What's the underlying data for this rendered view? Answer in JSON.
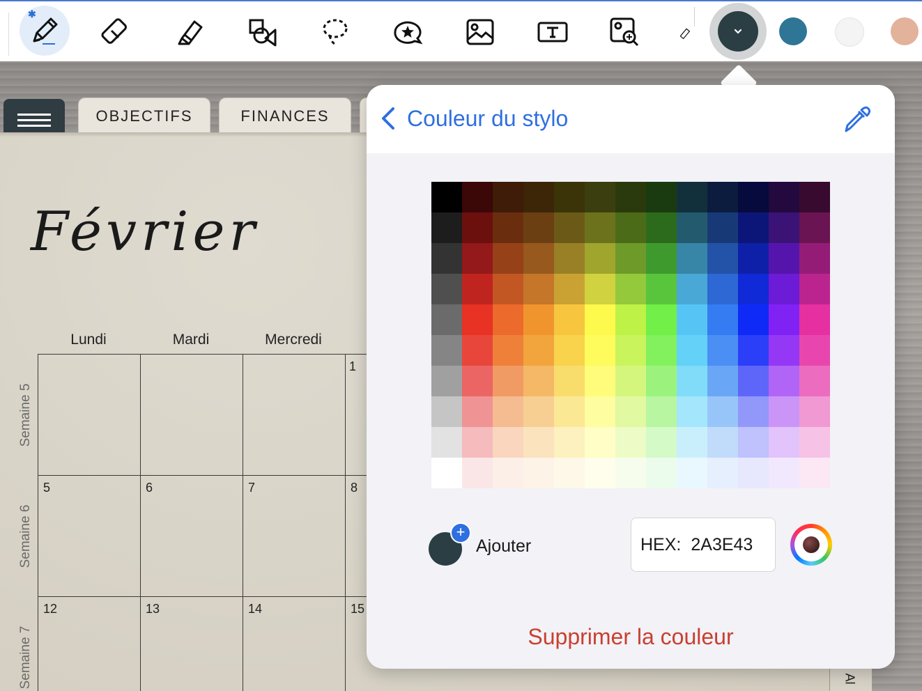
{
  "toolbar": {
    "tools": [
      {
        "name": "pen-tool",
        "icon": "pen-icon",
        "active": true
      },
      {
        "name": "eraser-tool",
        "icon": "eraser-icon"
      },
      {
        "name": "highlighter-tool",
        "icon": "highlighter-icon"
      },
      {
        "name": "shapes-tool",
        "icon": "shapes-icon"
      },
      {
        "name": "lasso-tool",
        "icon": "lasso-icon"
      },
      {
        "name": "sticker-tool",
        "icon": "sticker-icon"
      },
      {
        "name": "image-tool",
        "icon": "image-icon"
      },
      {
        "name": "text-tool",
        "icon": "text-box-icon"
      },
      {
        "name": "image-search-tool",
        "icon": "image-search-icon"
      },
      {
        "name": "ruler-tool",
        "icon": "ruler-icon"
      }
    ],
    "current_color": "#2a3e43",
    "swatches": [
      "#2f7596",
      "#f4f4f4",
      "#e2b29b"
    ]
  },
  "planner": {
    "tabs": [
      "OBJECTIFS",
      "FINANCES"
    ],
    "month": "Février",
    "day_headers": [
      "Lundi",
      "Mardi",
      "Mercredi"
    ],
    "weeks": [
      "Semaine 5",
      "Semaine 6",
      "Semaine 7"
    ],
    "days": {
      "w5": [
        "1"
      ],
      "w6": [
        "5",
        "6",
        "7",
        "8"
      ],
      "w7": [
        "12",
        "13",
        "14",
        "15"
      ]
    },
    "right_tab_partial": "Al"
  },
  "popover": {
    "title": "Couleur du stylo",
    "add_label": "Ajouter",
    "hex_label": "HEX:",
    "hex_value": "2A3E43",
    "delete_label": "Supprimer la couleur",
    "palette": [
      [
        "#000000",
        "#3b0707",
        "#3e1c08",
        "#3d2508",
        "#3b3409",
        "#3b3f0f",
        "#2b3a0c",
        "#1a3b0f",
        "#12303c",
        "#0b1c3f",
        "#060a3d",
        "#23093e",
        "#380a30"
      ],
      [
        "#1d1d1d",
        "#6b100d",
        "#6a2e0f",
        "#6b3f12",
        "#6b5a17",
        "#6c721c",
        "#4b6b18",
        "#2c6b1c",
        "#245a6e",
        "#173a76",
        "#0b1678",
        "#3b1376",
        "#6a1453"
      ],
      [
        "#333333",
        "#93191a",
        "#964117",
        "#97591d",
        "#998026",
        "#9fa52d",
        "#6e9a29",
        "#3f9a2d",
        "#3786a7",
        "#2353a8",
        "#0f20a8",
        "#5515ac",
        "#941c77"
      ],
      [
        "#4f4f4f",
        "#c0241e",
        "#c35724",
        "#c57629",
        "#caa233",
        "#d0d240",
        "#93c93a",
        "#59c53c",
        "#4aa8d6",
        "#2d68d4",
        "#0f2ad6",
        "#6c1bd6",
        "#bb248f"
      ],
      [
        "#6b6b6b",
        "#e73224",
        "#ec6a2c",
        "#f0952e",
        "#f7c63e",
        "#fdf94d",
        "#bef246",
        "#72ef48",
        "#56c5f6",
        "#357cf2",
        "#0f2af7",
        "#8122f5",
        "#e62fa1"
      ],
      [
        "#858585",
        "#e8463b",
        "#ee803a",
        "#f2a53c",
        "#f8d34b",
        "#fefb5d",
        "#c9f45c",
        "#82f15d",
        "#63d1f8",
        "#4b8ef4",
        "#2b3ff8",
        "#9438f5",
        "#e846ae"
      ],
      [
        "#a0a0a0",
        "#eb6564",
        "#f19b64",
        "#f4b866",
        "#f9dd6c",
        "#fefc7a",
        "#d5f67c",
        "#9bf37d",
        "#80dcf9",
        "#6aa6f6",
        "#5d66f8",
        "#b065f6",
        "#ec6cbf"
      ],
      [
        "#c5c5c5",
        "#f09394",
        "#f5bb91",
        "#f7cf92",
        "#fbe894",
        "#fefd9f",
        "#e1f9a1",
        "#b8f6a1",
        "#a4e6fb",
        "#98c5f9",
        "#9198fa",
        "#cb95f8",
        "#f199d3"
      ],
      [
        "#e2e2e2",
        "#f5bbbd",
        "#f9d6bd",
        "#fbe3be",
        "#fdf1bf",
        "#fefec6",
        "#edfbc6",
        "#d4fac7",
        "#c9effc",
        "#c1dbfb",
        "#bfc2fc",
        "#e2c3fb",
        "#f6c3e6"
      ],
      [
        "#ffffff",
        "#fbe6e7",
        "#fcefe7",
        "#fdf3e7",
        "#fef8e8",
        "#fffeec",
        "#f6fded",
        "#ebfced",
        "#e9f8fe",
        "#e6effd",
        "#e7e8fe",
        "#f2e8fd",
        "#fbe8f4"
      ]
    ]
  }
}
